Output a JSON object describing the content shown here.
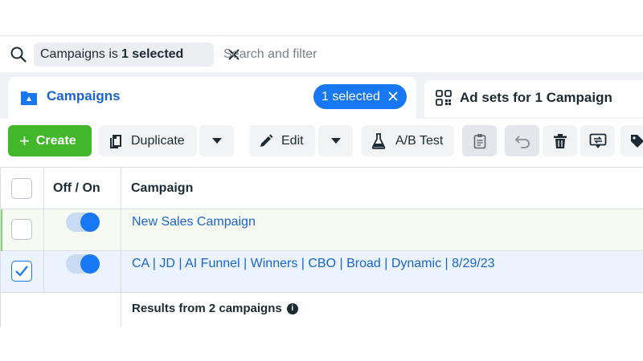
{
  "search": {
    "chip_prefix": "Campaigns is",
    "chip_value": "1 selected",
    "placeholder": "Search and filter",
    "value": ""
  },
  "tabs": {
    "active": {
      "label": "Campaigns",
      "icon": "campaigns-folder-icon",
      "badge": "1 selected"
    },
    "inactive": {
      "label": "Ad sets for 1 Campaign",
      "icon": "ad-sets-grid-icon"
    }
  },
  "toolbar": {
    "create": "Create",
    "duplicate": "Duplicate",
    "edit": "Edit",
    "ab_test": "A/B Test"
  },
  "table": {
    "headers": {
      "toggle": "Off / On",
      "campaign": "Campaign"
    },
    "rows": [
      {
        "name": "New Sales Campaign",
        "checked": false,
        "on": true
      },
      {
        "name": "CA | JD | AI Funnel | Winners | CBO | Broad | Dynamic | 8/29/23",
        "checked": true,
        "on": true
      }
    ],
    "summary": "Results from 2 campaigns"
  },
  "colors": {
    "accent": "#1877f2",
    "link": "#1b63d3",
    "create_green": "#42b72a",
    "selected_row": "#eaf3fe"
  }
}
